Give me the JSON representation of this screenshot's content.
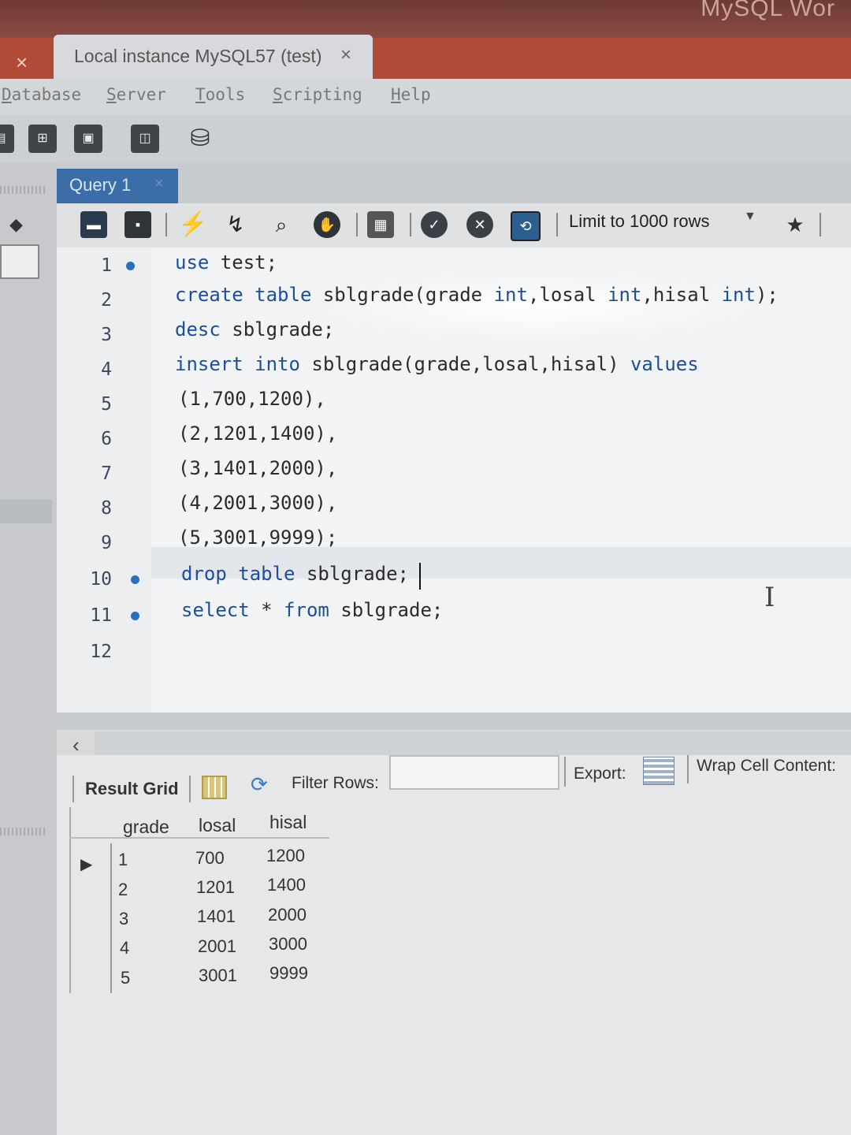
{
  "window": {
    "brand_partial": "MySQL Wor",
    "tab_title": "Local instance MySQL57 (test)",
    "tab_close": "×",
    "left_close": "×"
  },
  "menu": [
    "Database",
    "Server",
    "Tools",
    "Scripting",
    "Help"
  ],
  "query_tab": {
    "label": "Query 1",
    "close": "×"
  },
  "query_toolbar": {
    "limit_label": "Limit to 1000 rows"
  },
  "editor": {
    "lines": [
      {
        "num": "1",
        "marker": true,
        "text": "use test;"
      },
      {
        "num": "2",
        "marker": false,
        "text": "create table sblgrade(grade int,losal int,hisal int);"
      },
      {
        "num": "3",
        "marker": false,
        "text": "desc sblgrade;"
      },
      {
        "num": "4",
        "marker": false,
        "text": "insert into sblgrade(grade,losal,hisal) values"
      },
      {
        "num": "5",
        "marker": false,
        "text": "(1,700,1200),"
      },
      {
        "num": "6",
        "marker": false,
        "text": "(2,1201,1400),"
      },
      {
        "num": "7",
        "marker": false,
        "text": "(3,1401,2000),"
      },
      {
        "num": "8",
        "marker": false,
        "text": "(4,2001,3000),"
      },
      {
        "num": "9",
        "marker": false,
        "text": "(5,3001,9999);"
      },
      {
        "num": "10",
        "marker": true,
        "text": "drop table sblgrade;"
      },
      {
        "num": "11",
        "marker": true,
        "text": "select * from sblgrade;"
      },
      {
        "num": "12",
        "marker": false,
        "text": ""
      }
    ]
  },
  "results": {
    "label": "Result Grid",
    "filter_label": "Filter Rows:",
    "export_label": "Export:",
    "wrap_label": "Wrap Cell Content:",
    "columns": [
      "grade",
      "losal",
      "hisal"
    ],
    "rows": [
      [
        "1",
        "700",
        "1200"
      ],
      [
        "2",
        "1201",
        "1400"
      ],
      [
        "3",
        "1401",
        "2000"
      ],
      [
        "4",
        "2001",
        "3000"
      ],
      [
        "5",
        "3001",
        "9999"
      ]
    ]
  }
}
